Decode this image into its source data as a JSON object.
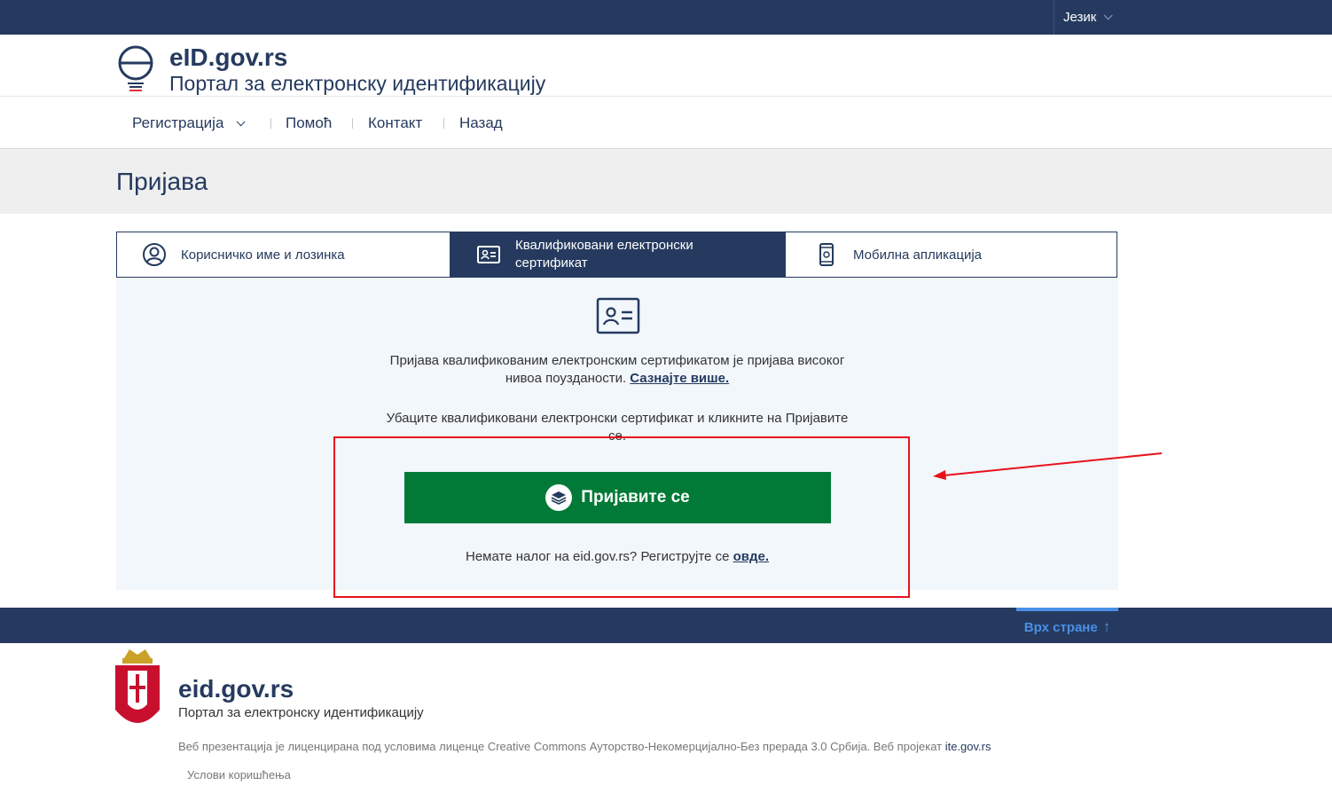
{
  "topbar": {
    "language_label": "Језик"
  },
  "header": {
    "brand_title": "eID.gov.rs",
    "brand_subtitle": "Портал за електронску идентификацију"
  },
  "nav": {
    "items": [
      {
        "label": "Регистрација",
        "has_dropdown": true
      },
      {
        "label": "Помоћ"
      },
      {
        "label": "Контакт"
      },
      {
        "label": "Назад"
      }
    ]
  },
  "page": {
    "title": "Пријава"
  },
  "tabs": [
    {
      "label": "Корисничко име и лозинка",
      "icon": "user-icon",
      "active": false
    },
    {
      "label": "Квалификовани електронски сертификат",
      "icon": "id-card-icon",
      "active": true
    },
    {
      "label": "Мобилна апликација",
      "icon": "mobile-phone-icon",
      "active": false
    }
  ],
  "content": {
    "intro_text": "Пријава квалификованим електронским сертификатом је пријава високог нивоа поузданости.",
    "learn_more_link": "Сазнајте више.",
    "instruction_text": "Убаците квалификовани електронски сертификат и кликните на Пријавите се.",
    "login_button": "Пријавите се",
    "register_text": "Немате налог на eid.gov.rs? Региструјте се",
    "register_link": "овде."
  },
  "footer": {
    "back_to_top": "Врх стране",
    "title": "eid.gov.rs",
    "subtitle": "Портал за електронску идентификацију",
    "license_text": "Веб презентација је лиценцирана под условима лиценце Creative Commons Ауторство-Некомерцијално-Без прерада 3.0 Србија. Веб пројекат",
    "license_link": "ite.gov.rs",
    "terms": "Услови коришћења"
  },
  "colors": {
    "primary": "#253a5e",
    "login_button": "#007a36",
    "panel_background": "#f2f7fc",
    "annotation_red": "#e8121b",
    "back_to_top": "#4a8fe7"
  }
}
